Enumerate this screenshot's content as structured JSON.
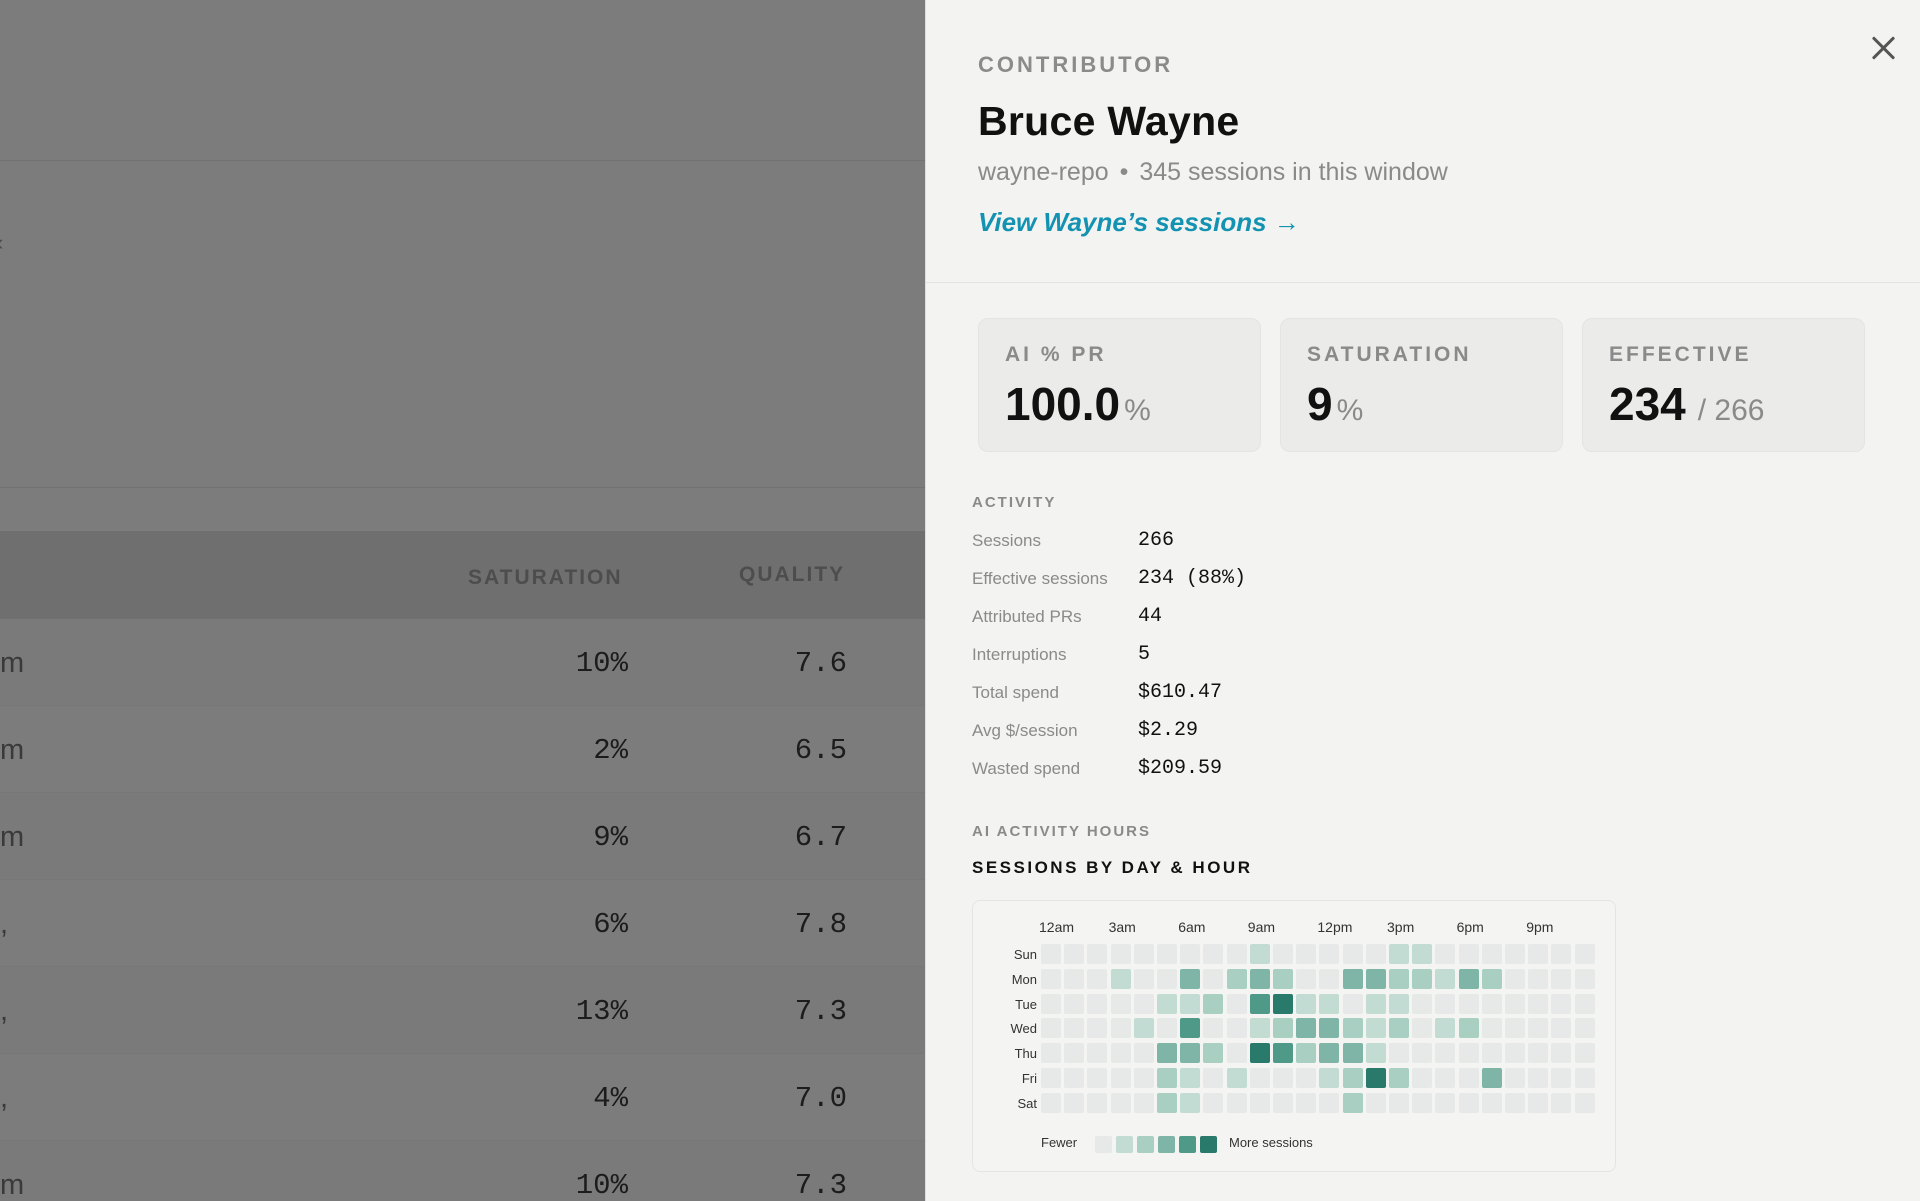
{
  "background_table": {
    "columns": [
      "SATURATION",
      "QUALITY"
    ],
    "rows": [
      {
        "lead": "m",
        "saturation": "10%",
        "quality": "7.6"
      },
      {
        "lead": "m",
        "saturation": "2%",
        "quality": "6.5"
      },
      {
        "lead": "m",
        "saturation": "9%",
        "quality": "6.7"
      },
      {
        "lead": ",",
        "saturation": "6%",
        "quality": "7.8"
      },
      {
        "lead": ",",
        "saturation": "13%",
        "quality": "7.3"
      },
      {
        "lead": ",",
        "saturation": "4%",
        "quality": "7.0"
      },
      {
        "lead": "m",
        "saturation": "10%",
        "quality": "7.3"
      }
    ]
  },
  "drawer": {
    "eyebrow": "CONTRIBUTOR",
    "name": "Bruce Wayne",
    "repo": "wayne-repo",
    "separator": "•",
    "sessions_note": "345 sessions in this window",
    "link_label": "View Wayne’s sessions →",
    "close_icon": "close-icon",
    "cards": [
      {
        "label": "AI % PR",
        "value": "100.0",
        "unit": "%"
      },
      {
        "label": "SATURATION",
        "value": "9",
        "unit": "%"
      },
      {
        "label": "EFFECTIVE",
        "value": "234",
        "unit": "/ 266"
      }
    ],
    "activity_title": "ACTIVITY",
    "activity": [
      {
        "key": "Sessions",
        "value": "266"
      },
      {
        "key": "Effective sessions",
        "value": "234 (88%)"
      },
      {
        "key": "Attributed PRs",
        "value": "44"
      },
      {
        "key": "Interruptions",
        "value": "5"
      },
      {
        "key": "Total spend",
        "value": "$610.47"
      },
      {
        "key": "Avg $/session",
        "value": "$2.29"
      },
      {
        "key": "Wasted spend",
        "value": "$209.59"
      }
    ],
    "hours_title": "AI ACTIVITY HOURS",
    "heatmap": {
      "title": "SESSIONS BY DAY & HOUR",
      "hour_labels": [
        {
          "label": "12am",
          "hour": 0
        },
        {
          "label": "3am",
          "hour": 3
        },
        {
          "label": "6am",
          "hour": 6
        },
        {
          "label": "9am",
          "hour": 9
        },
        {
          "label": "12pm",
          "hour": 12
        },
        {
          "label": "3pm",
          "hour": 15
        },
        {
          "label": "6pm",
          "hour": 18
        },
        {
          "label": "9pm",
          "hour": 21
        }
      ],
      "days": [
        "Sun",
        "Mon",
        "Tue",
        "Wed",
        "Thu",
        "Fri",
        "Sat"
      ],
      "levels": [
        [
          0,
          0,
          0,
          0,
          0,
          0,
          0,
          0,
          0,
          1,
          0,
          0,
          0,
          0,
          0,
          1,
          1,
          0,
          0,
          0,
          0,
          0,
          0,
          0
        ],
        [
          0,
          0,
          0,
          1,
          0,
          0,
          3,
          0,
          2,
          3,
          2,
          0,
          0,
          3,
          3,
          2,
          2,
          1,
          3,
          2,
          0,
          0,
          0,
          0
        ],
        [
          0,
          0,
          0,
          0,
          0,
          1,
          1,
          2,
          0,
          4,
          5,
          1,
          1,
          0,
          1,
          1,
          0,
          0,
          0,
          0,
          0,
          0,
          0,
          0
        ],
        [
          0,
          0,
          0,
          0,
          1,
          0,
          4,
          0,
          0,
          1,
          2,
          3,
          3,
          2,
          1,
          2,
          0,
          1,
          2,
          0,
          0,
          0,
          0,
          0
        ],
        [
          0,
          0,
          0,
          0,
          0,
          3,
          3,
          2,
          0,
          5,
          4,
          2,
          3,
          3,
          1,
          0,
          0,
          0,
          0,
          0,
          0,
          0,
          0,
          0
        ],
        [
          0,
          0,
          0,
          0,
          0,
          2,
          1,
          0,
          1,
          0,
          0,
          0,
          1,
          2,
          5,
          2,
          0,
          0,
          0,
          3,
          0,
          0,
          0,
          0
        ],
        [
          0,
          0,
          0,
          0,
          0,
          2,
          1,
          0,
          0,
          0,
          0,
          0,
          0,
          2,
          0,
          0,
          0,
          0,
          0,
          0,
          0,
          0,
          0,
          0
        ]
      ],
      "palette": [
        "#e6e9e8",
        "#c2dcd3",
        "#a8cfc1",
        "#7fb5a6",
        "#4f9988",
        "#2a7a6b"
      ],
      "legend_fewer": "Fewer",
      "legend_more": "More sessions"
    }
  }
}
